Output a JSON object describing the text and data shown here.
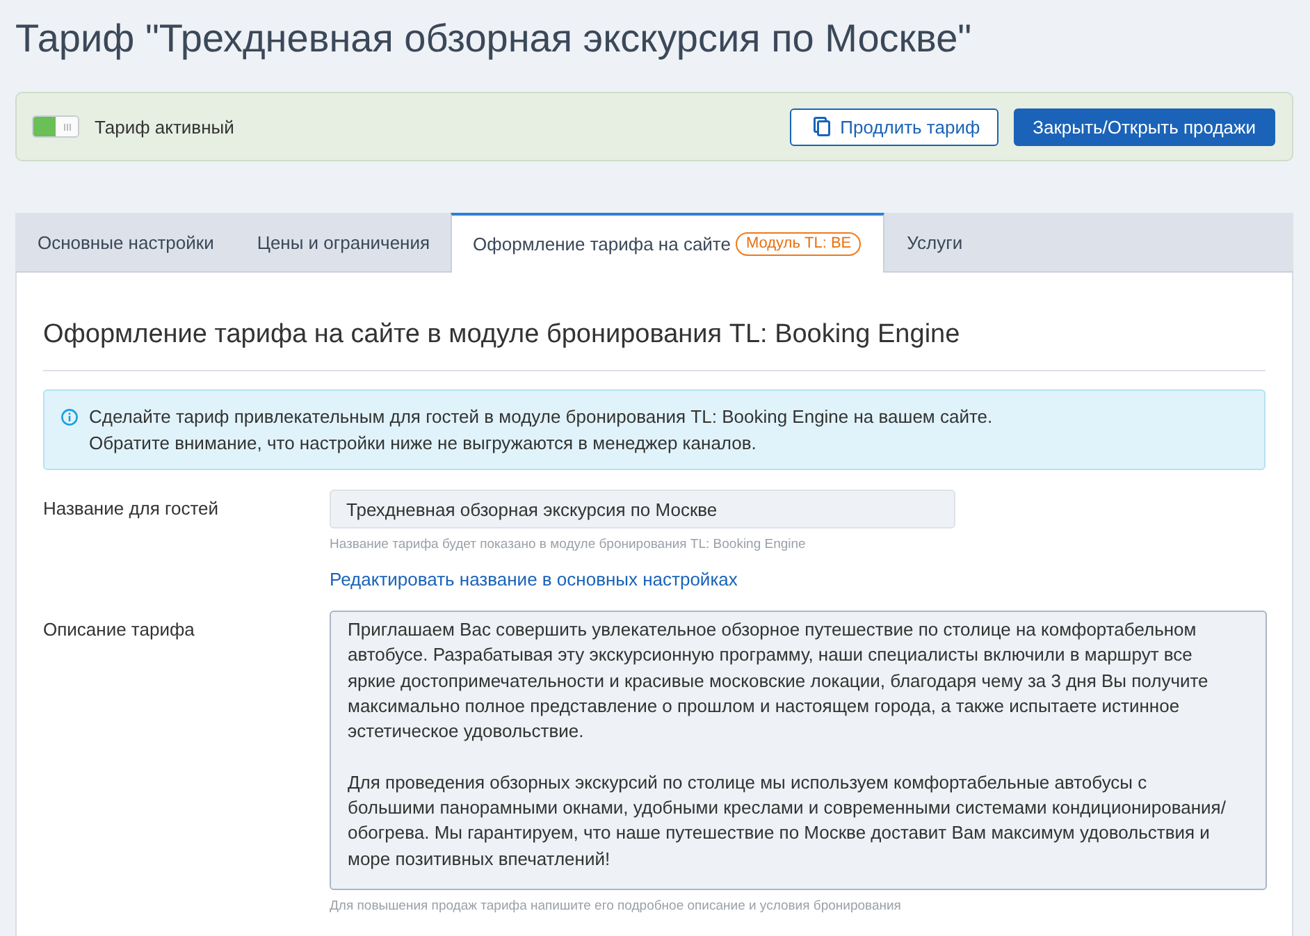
{
  "page": {
    "title": "Тариф \"Трехдневная обзорная экскурсия по Москве\""
  },
  "status_panel": {
    "toggle": {
      "label": "Тариф активный",
      "on": true
    },
    "buttons": [
      {
        "kind": "outline",
        "label": "Продлить тариф"
      },
      {
        "kind": "primary",
        "label": "Закрыть/Открыть продажи"
      }
    ]
  },
  "tabs": [
    {
      "label": "Основные настройки",
      "selected": false
    },
    {
      "label": "Цены и ограничения",
      "selected": false
    },
    {
      "label": "Оформление тарифа на сайте",
      "badge": "Модуль TL: BE",
      "selected": true
    },
    {
      "label": "Услуги",
      "selected": false
    }
  ],
  "section": {
    "title": "Оформление тарифа на сайте в модуле бронирования TL: Booking Engine",
    "info": [
      "Сделайте тариф привлекательным для гостей в модуле бронирования TL: Booking Engine на вашем сайте.",
      "Обратите внимание, что настройки ниже не выгружаются в менеджер каналов."
    ],
    "fields": [
      {
        "kind": "input",
        "label": "Название для гостей",
        "value": "Трехдневная обзорная экскурсия по Москве",
        "hint": "Название тарифа будет показано в модуле бронирования TL: Booking Engine",
        "link": "Редактировать название в основных настройках"
      },
      {
        "kind": "textarea",
        "label": "Описание тарифа",
        "paragraphs": [
          "Приглашаем Вас совершить увлекательное обзорное путешествие по столице на комфортабельном автобусе. Разрабатывая эту экскурсионную программу, наши специалисты включили в маршрут все яркие достопримечательности и красивые московские локации, благодаря чему за 3 дня Вы получите максимально полное представление о прошлом и настоящем города, а также испытаете истинное эстетическое удовольствие.",
          "Для проведения обзорных экскурсий по столице мы используем комфортабельные автобусы с большими панорамными окнами, удобными креслами и современными системами кондиционирования/обогрева. Мы гарантируем, что наше путешествие по Москве доставит Вам максимум удовольствия и море позитивных впечатлений!"
        ],
        "hint": "Для повышения продаж тарифа напишите его подробное описание и условия бронирования"
      }
    ]
  }
}
